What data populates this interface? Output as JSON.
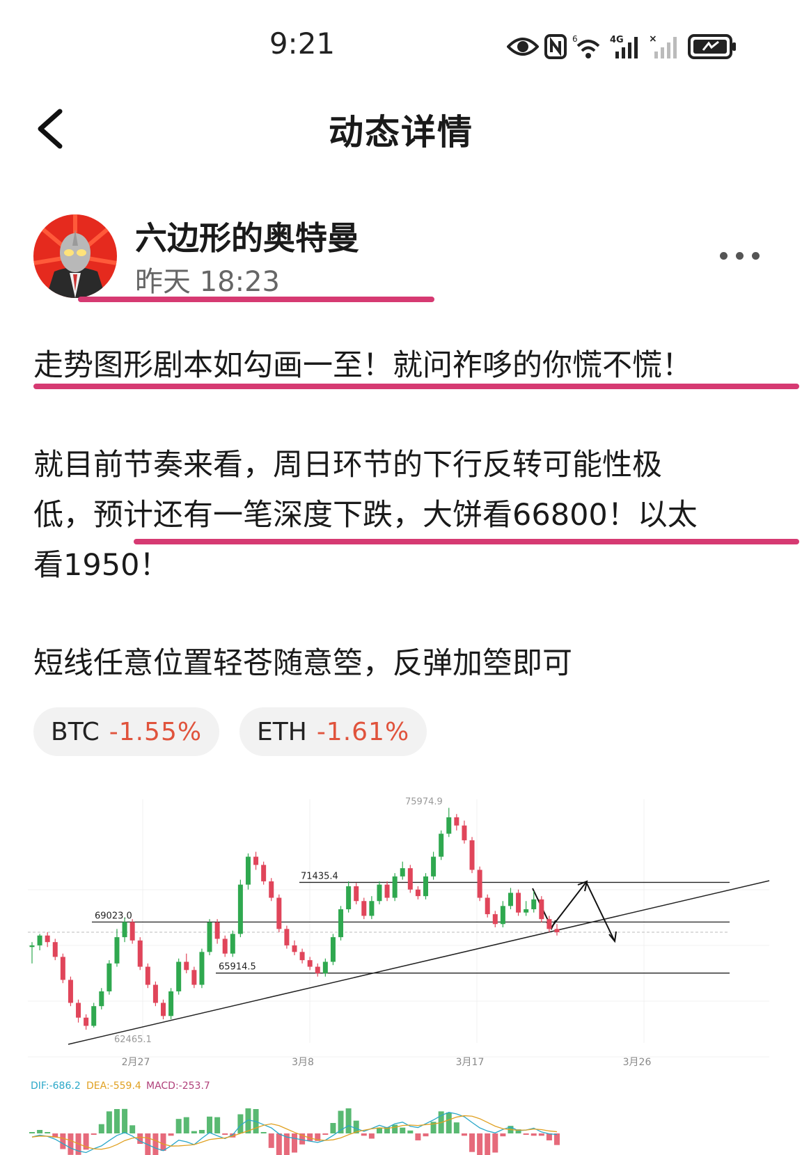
{
  "status_bar": {
    "time": "9:21",
    "icons": [
      "eye-icon",
      "nfc-icon",
      "wifi-icon",
      "signal-4g-icon",
      "signal-icon",
      "battery-icon"
    ]
  },
  "header": {
    "title": "动态详情",
    "back_icon": "chevron-left-icon"
  },
  "author": {
    "name": "六边形的奥特曼",
    "time": "昨天 18:23"
  },
  "post": {
    "headline": "走势图形剧本如勾画一至！就问祚哆的你慌不慌！",
    "lines": [
      "就目前节奏来看，周日环节的下行反转可能性极",
      "低，预计还有一笔深度下跌，大饼看66800！以太",
      "看1950！"
    ],
    "short_line": "短线任意位置轻苍随意箜，反弹加箜即可"
  },
  "tags": [
    {
      "symbol": "BTC",
      "change": "-1.55%"
    },
    {
      "symbol": "ETH",
      "change": "-1.61%"
    }
  ],
  "colors": {
    "accent_underline": "#d63a72",
    "negative": "#e0533c",
    "candle_up": "#2fa84f",
    "candle_down": "#e0455a"
  },
  "chart_data": {
    "type": "candlestick",
    "x_labels": [
      "2月27",
      "3月8",
      "3月17",
      "3月26"
    ],
    "price_labels": [
      "75974.9",
      "71435.4",
      "69023.0",
      "65914.5",
      "62465.1"
    ],
    "levels": [
      71435.4,
      69023.0,
      65914.5
    ],
    "ylim": [
      62000,
      76500
    ],
    "high": 75974.9,
    "low": 62465.1,
    "candles": [
      [
        67500,
        67600,
        66500,
        67800
      ],
      [
        67600,
        68200,
        67300,
        68300
      ],
      [
        68200,
        67800,
        67500,
        68400
      ],
      [
        67800,
        66900,
        66700,
        68000
      ],
      [
        66900,
        65500,
        65300,
        67100
      ],
      [
        65500,
        64100,
        63900,
        65700
      ],
      [
        64100,
        63200,
        62900,
        64300
      ],
      [
        63200,
        62700,
        62465.1,
        63400
      ],
      [
        62700,
        63900,
        62600,
        64100
      ],
      [
        63900,
        64800,
        63700,
        65000
      ],
      [
        64800,
        66500,
        64600,
        66700
      ],
      [
        66500,
        68100,
        66300,
        68600
      ],
      [
        68100,
        69023,
        67800,
        69300
      ],
      [
        69023,
        67900,
        67700,
        69200
      ],
      [
        67900,
        66300,
        66100,
        68100
      ],
      [
        66300,
        65200,
        65000,
        66500
      ],
      [
        65200,
        64100,
        63900,
        65400
      ],
      [
        64100,
        63300,
        63100,
        64300
      ],
      [
        63300,
        64800,
        63100,
        65000
      ],
      [
        64800,
        66600,
        64600,
        66800
      ],
      [
        66600,
        66100,
        65900,
        67100
      ],
      [
        66100,
        65200,
        65000,
        66300
      ],
      [
        65200,
        67200,
        65000,
        67400
      ],
      [
        67200,
        69000,
        67000,
        69200
      ],
      [
        69000,
        68000,
        67700,
        69200
      ],
      [
        68000,
        67100,
        66900,
        68200
      ],
      [
        67100,
        68300,
        66900,
        68500
      ],
      [
        68300,
        71300,
        68100,
        71600
      ],
      [
        71300,
        73000,
        71000,
        73200
      ],
      [
        73000,
        72500,
        72200,
        73300
      ],
      [
        72500,
        71500,
        71300,
        72700
      ],
      [
        71500,
        70500,
        70300,
        71700
      ],
      [
        70500,
        68600,
        68400,
        70700
      ],
      [
        68600,
        67600,
        67400,
        68800
      ],
      [
        67600,
        67200,
        67000,
        67900
      ],
      [
        67200,
        66700,
        66500,
        67400
      ],
      [
        66700,
        66300,
        66100,
        66900
      ],
      [
        66300,
        65900,
        65700,
        66500
      ],
      [
        65900,
        66600,
        65700,
        66800
      ],
      [
        66600,
        68100,
        66400,
        68300
      ],
      [
        68100,
        69800,
        67900,
        70000
      ],
      [
        69800,
        71200,
        69600,
        71500
      ],
      [
        71200,
        70300,
        70100,
        71400
      ],
      [
        70300,
        69400,
        69200,
        70500
      ],
      [
        69400,
        70300,
        69200,
        70600
      ],
      [
        70300,
        71300,
        70100,
        71500
      ],
      [
        71300,
        70500,
        70300,
        71500
      ],
      [
        70500,
        71800,
        70300,
        72000
      ],
      [
        71800,
        72300,
        71600,
        72700
      ],
      [
        72300,
        71000,
        70800,
        72500
      ],
      [
        71000,
        70600,
        70400,
        71200
      ],
      [
        70600,
        71800,
        70400,
        72000
      ],
      [
        71800,
        73000,
        71600,
        73300
      ],
      [
        73000,
        74400,
        72800,
        74600
      ],
      [
        74400,
        75400,
        74200,
        75974.9
      ],
      [
        75400,
        74900,
        74600,
        75600
      ],
      [
        74900,
        74000,
        73800,
        75200
      ],
      [
        74000,
        72200,
        72000,
        74200
      ],
      [
        72200,
        70500,
        70300,
        72400
      ],
      [
        70500,
        69500,
        69300,
        70700
      ],
      [
        69500,
        68900,
        68700,
        69700
      ],
      [
        68900,
        70000,
        68700,
        70300
      ],
      [
        70000,
        70800,
        69800,
        71100
      ],
      [
        70800,
        69600,
        69400,
        71000
      ],
      [
        69600,
        69800,
        69400,
        70300
      ],
      [
        69800,
        70400,
        69600,
        70900
      ],
      [
        70400,
        69200,
        69000,
        70600
      ],
      [
        69200,
        68600,
        68400,
        69400
      ],
      [
        68600,
        68400,
        68200,
        68900
      ]
    ],
    "macd": {
      "dif": -686.2,
      "dea": -559.4,
      "macd": -253.7,
      "labels": [
        "DIF:-686.2",
        "DEA:-559.4",
        "MACD:-253.7"
      ]
    }
  }
}
